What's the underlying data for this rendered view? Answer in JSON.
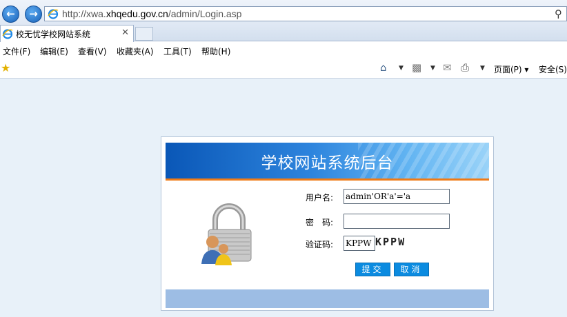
{
  "browser": {
    "url_prefix": "http://xwa.",
    "url_domain": "xhqedu.gov.cn",
    "url_path": "/admin/Login.asp",
    "tab_title": "校无忧学校网站系统",
    "menu": [
      "文件(F)",
      "编辑(E)",
      "查看(V)",
      "收藏夹(A)",
      "工具(T)",
      "帮助(H)"
    ],
    "commands": {
      "page": "页面(P)",
      "safety": "安全(S)"
    }
  },
  "login": {
    "title": "学校网站系统后台",
    "username_label": "用户名:",
    "username_value": "admin'OR'a'='a",
    "password_label": "密　码:",
    "password_value": "",
    "captcha_label": "验证码:",
    "captcha_value": "KPPW",
    "captcha_image_text": "KPPW",
    "submit_label": "提交",
    "cancel_label": "取消"
  },
  "colors": {
    "banner": "#0a57b7",
    "accent_bar": "#f07b16",
    "button": "#0b8be0",
    "footer_bar": "#9dbde4"
  }
}
